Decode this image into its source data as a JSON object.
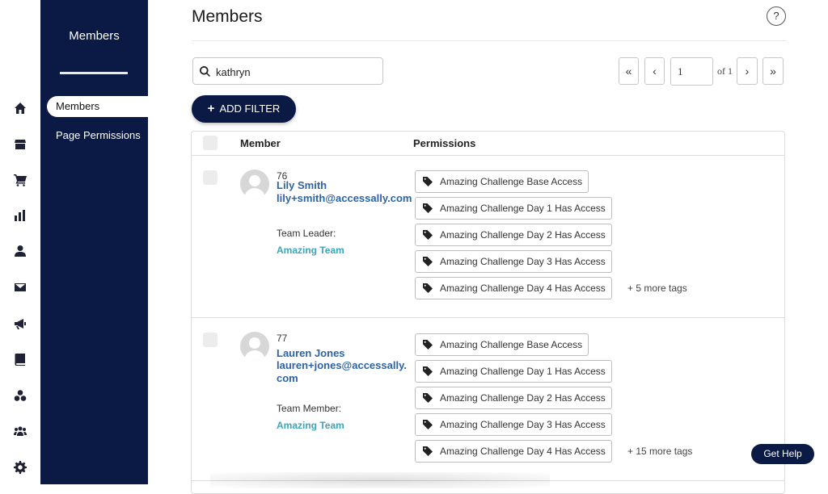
{
  "rail": {
    "icons": [
      "home-icon",
      "store-icon",
      "cart-icon",
      "chart-icon",
      "user-icon",
      "envelope-icon",
      "megaphone-icon",
      "book-icon",
      "groups-icon",
      "people-icon",
      "gear-icon"
    ]
  },
  "subnav": {
    "title": "Members",
    "items": [
      {
        "label": "Members",
        "active": true
      },
      {
        "label": "Page Permissions",
        "active": false
      }
    ]
  },
  "page": {
    "title": "Members",
    "help_glyph": "?"
  },
  "search": {
    "value": "kathryn"
  },
  "pagination": {
    "first": "«",
    "prev": "‹",
    "current": "1",
    "of_label": "of 1",
    "next": "›",
    "last": "»"
  },
  "filter": {
    "add_label": "ADD FILTER"
  },
  "table": {
    "columns": [
      "Member",
      "Permissions"
    ],
    "rows": [
      {
        "id": "76",
        "name": "Lily Smith",
        "email": "lily+smith@accessally.com",
        "role": "Team Leader:",
        "team": "Amazing Team",
        "tags": [
          "Amazing Challenge Base Access",
          "Amazing Challenge Day 1 Has Access",
          "Amazing Challenge Day 2 Has Access",
          "Amazing Challenge Day 3 Has Access",
          "Amazing Challenge Day 4 Has Access"
        ],
        "more": "+ 5 more tags"
      },
      {
        "id": "77",
        "name": "Lauren Jones",
        "email": "lauren+jones@accessally.com",
        "role": "Team Member:",
        "team": "Amazing Team",
        "tags": [
          "Amazing Challenge Base Access",
          "Amazing Challenge Day 1 Has Access",
          "Amazing Challenge Day 2 Has Access",
          "Amazing Challenge Day 3 Has Access",
          "Amazing Challenge Day 4 Has Access"
        ],
        "more": "+ 15 more tags"
      }
    ]
  },
  "help_button": {
    "label": "Get Help"
  },
  "colors": {
    "navy": "#0b1a44",
    "link_blue": "#2b63a8",
    "team_teal": "#3aa6b9"
  }
}
